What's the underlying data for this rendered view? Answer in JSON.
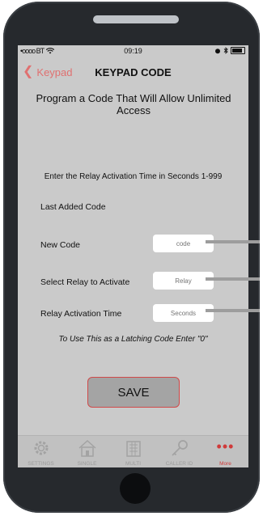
{
  "status_bar": {
    "carrier": "•oooo BT",
    "time": "09:19",
    "wifi_icon": "wifi-icon",
    "bluetooth_icon": "bluetooth-icon",
    "alarm_icon": "alarm-icon",
    "battery_icon": "battery-icon"
  },
  "navbar": {
    "back_label": "Keypad",
    "title": "KEYPAD CODE",
    "accent_color": "#e07070"
  },
  "content": {
    "heading": "Program a Code That Will Allow Unlimited Access",
    "instruction": "Enter the Relay Activation Time in Seconds 1-999",
    "last_added_label": "Last Added Code",
    "new_code_label": "New Code",
    "new_code_placeholder": "code",
    "relay_label": "Select Relay to Activate",
    "relay_placeholder": "Relay",
    "time_label": "Relay Activation Time",
    "time_placeholder": "Seconds",
    "latching_note": "To Use This as a Latching Code Enter \"0\"",
    "save_label": "SAVE"
  },
  "tabbar": {
    "tabs": [
      {
        "label": "SETTINGS",
        "icon": "gear-icon"
      },
      {
        "label": "SINGLE",
        "icon": "house-icon"
      },
      {
        "label": "MULTI",
        "icon": "building-icon"
      },
      {
        "label": "CALLER ID",
        "icon": "key-icon"
      },
      {
        "label": "More",
        "icon": "more-icon"
      }
    ],
    "active_color": "#d03a3a"
  }
}
